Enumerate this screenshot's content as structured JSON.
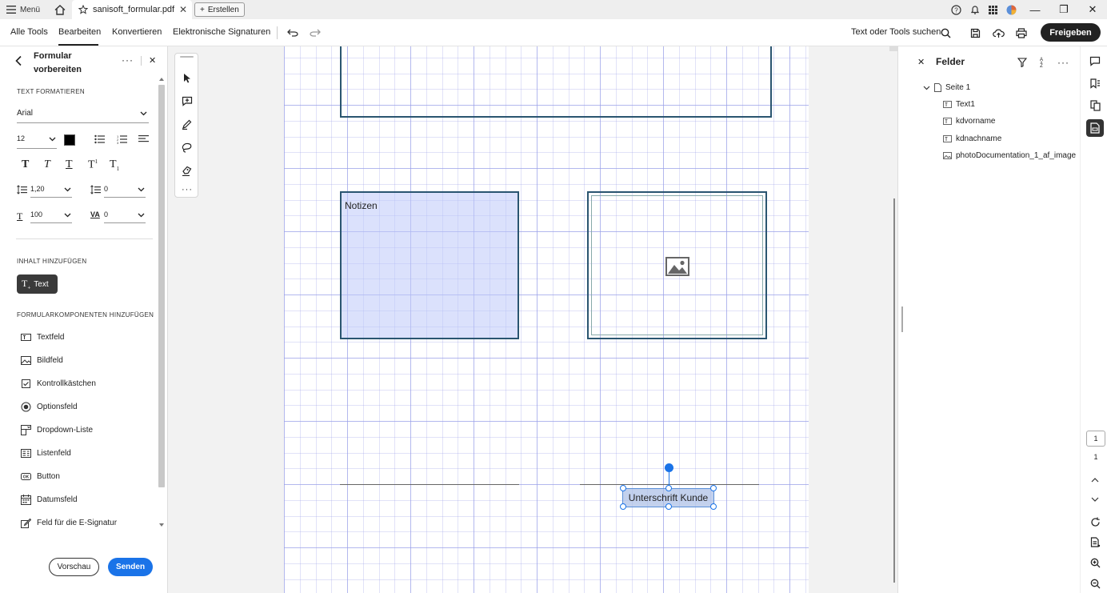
{
  "titlebar": {
    "menu_label": "Menü",
    "doc_tab_label": "sanisoft_formular.pdf",
    "create_label": "Erstellen"
  },
  "toolbar": {
    "tabs": [
      {
        "label": "Alle Tools"
      },
      {
        "label": "Bearbeiten"
      },
      {
        "label": "Konvertieren"
      },
      {
        "label": "Elektronische Signaturen"
      }
    ],
    "active_tab": "Bearbeiten",
    "search_label": "Text oder Tools suchen",
    "share_label": "Freigeben"
  },
  "left_panel": {
    "title": "Formular vorbereiten",
    "format_section": "TEXT FORMATIEREN",
    "font": "Arial",
    "font_size": "12",
    "font_color": "#000000",
    "line_spacing": "1,20",
    "paragraph_spacing": "0",
    "horizontal_scale": "100",
    "char_spacing": "0",
    "content_section": "INHALT HINZUFÜGEN",
    "text_button": "Text",
    "components_section": "FORMULARKOMPONENTEN HINZUFÜGEN",
    "components": [
      {
        "label": "Textfeld",
        "icon": "textfield-icon"
      },
      {
        "label": "Bildfeld",
        "icon": "image-field-icon"
      },
      {
        "label": "Kontrollkästchen",
        "icon": "checkbox-icon"
      },
      {
        "label": "Optionsfeld",
        "icon": "radio-icon"
      },
      {
        "label": "Dropdown-Liste",
        "icon": "dropdown-icon"
      },
      {
        "label": "Listenfeld",
        "icon": "listbox-icon"
      },
      {
        "label": "Button",
        "icon": "button-icon"
      },
      {
        "label": "Datumsfeld",
        "icon": "date-icon"
      },
      {
        "label": "Feld für die E-Signatur",
        "icon": "esign-icon"
      }
    ],
    "preview_label": "Vorschau",
    "send_label": "Senden"
  },
  "canvas": {
    "notes_label": "Notizen",
    "signature_label": "Unterschrift Kunde"
  },
  "fields_panel": {
    "title": "Felder",
    "page_label": "Seite 1",
    "fields": [
      {
        "label": "Text1",
        "icon": "textfield-icon"
      },
      {
        "label": "kdvorname",
        "icon": "textfield-icon"
      },
      {
        "label": "kdnachname",
        "icon": "textfield-icon"
      },
      {
        "label": "photoDocumentation_1_af_image",
        "icon": "image-field-icon"
      }
    ]
  },
  "pager": {
    "current_page": "1",
    "total_pages": "1"
  },
  "colors": {
    "accent": "#1a73e8",
    "form_border": "#2a5570",
    "notes_fill": "#c8d0fa",
    "grid": "#9aa0e8"
  }
}
